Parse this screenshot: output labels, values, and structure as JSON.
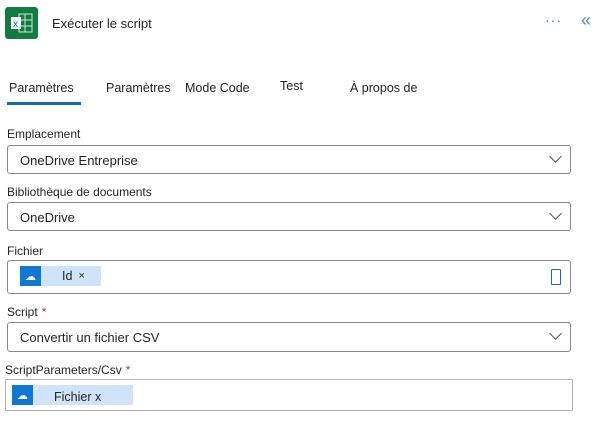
{
  "header": {
    "title": "Exécuter le script",
    "more": "···",
    "collapse": "«"
  },
  "tabs": [
    {
      "label": "Paramètres",
      "active": true
    },
    {
      "label": "Paramètres"
    },
    {
      "label": "Mode Code"
    },
    {
      "label": "Test"
    },
    {
      "label": "À propos de"
    }
  ],
  "fields": {
    "location": {
      "label": "Emplacement",
      "value": "OneDrive Entreprise"
    },
    "library": {
      "label": "Bibliothèque de documents",
      "value": "OneDrive"
    },
    "file": {
      "label": "Fichier",
      "token": "Id",
      "remove": "×"
    },
    "script": {
      "label": "Script",
      "required": "*",
      "value": "Convertir un fichier CSV"
    },
    "csv": {
      "label": "ScriptParameters/Csv",
      "required": "*",
      "token": "Fichier x"
    }
  },
  "colors": {
    "accent": "#0f6cbd",
    "excel": "#107c41"
  }
}
